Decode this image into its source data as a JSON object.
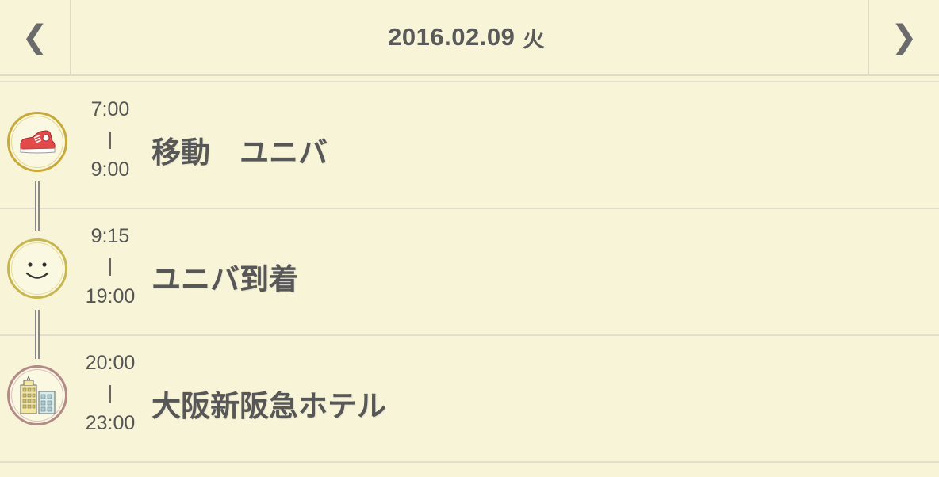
{
  "header": {
    "prev_label": "❮",
    "next_label": "❯",
    "date": "2016.02.09",
    "weekday": "火"
  },
  "events": [
    {
      "start": "7:00",
      "end": "9:00",
      "title": "移動　ユニバ",
      "icon": "sneaker-icon"
    },
    {
      "start": "9:15",
      "end": "19:00",
      "title": "ユニバ到着",
      "icon": "smiley-icon"
    },
    {
      "start": "20:00",
      "end": "23:00",
      "title": "大阪新阪急ホテル",
      "icon": "buildings-icon"
    }
  ],
  "colors": {
    "background": "#f8f4d8",
    "text": "#575757",
    "divider": "#e2decb",
    "sneaker_red": "#e04848"
  }
}
